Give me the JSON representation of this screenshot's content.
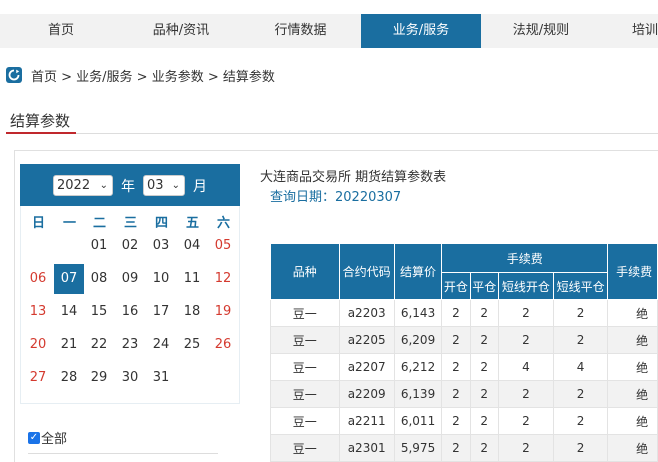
{
  "nav": {
    "items": [
      {
        "label": "首页",
        "active": false
      },
      {
        "label": "品种/资讯",
        "active": false
      },
      {
        "label": "行情数据",
        "active": false
      },
      {
        "label": "业务/服务",
        "active": true
      },
      {
        "label": "法规/规则",
        "active": false
      },
      {
        "label": "培训",
        "active": false
      }
    ]
  },
  "breadcrumb": {
    "text": "首页 > 业务/服务 > 业务参数 > 结算参数"
  },
  "section_title": "结算参数",
  "calendar": {
    "year": "2022",
    "year_unit": "年",
    "month": "03",
    "month_unit": "月",
    "weekdays": [
      "日",
      "一",
      "二",
      "三",
      "四",
      "五",
      "六"
    ],
    "days": [
      [
        "",
        "",
        "01",
        "02",
        "03",
        "04",
        "05"
      ],
      [
        "06",
        "07",
        "08",
        "09",
        "10",
        "11",
        "12"
      ],
      [
        "13",
        "14",
        "15",
        "16",
        "17",
        "18",
        "19"
      ],
      [
        "20",
        "21",
        "22",
        "23",
        "24",
        "25",
        "26"
      ],
      [
        "27",
        "28",
        "29",
        "30",
        "31",
        "",
        ""
      ]
    ],
    "selected_day": "07"
  },
  "filter": {
    "all_label": "全部",
    "all_checked": true
  },
  "report": {
    "title": "大连商品交易所 期货结算参数表",
    "query_date": "查询日期：20220307"
  },
  "table": {
    "headers": {
      "variety": "品种",
      "contract": "合约代码",
      "settle_price": "结算价",
      "fee_group": "手续费",
      "open": "开仓",
      "close": "平仓",
      "short_open": "短线开仓",
      "short_close": "短线平仓",
      "fee_mode": "手续费"
    },
    "rows": [
      {
        "variety": "豆一",
        "contract": "a2203",
        "price": "6,143",
        "open": "2",
        "close": "2",
        "short_open": "2",
        "short_close": "2",
        "mode": "绝"
      },
      {
        "variety": "豆一",
        "contract": "a2205",
        "price": "6,209",
        "open": "2",
        "close": "2",
        "short_open": "2",
        "short_close": "2",
        "mode": "绝"
      },
      {
        "variety": "豆一",
        "contract": "a2207",
        "price": "6,212",
        "open": "2",
        "close": "2",
        "short_open": "4",
        "short_close": "4",
        "mode": "绝"
      },
      {
        "variety": "豆一",
        "contract": "a2209",
        "price": "6,139",
        "open": "2",
        "close": "2",
        "short_open": "2",
        "short_close": "2",
        "mode": "绝"
      },
      {
        "variety": "豆一",
        "contract": "a2211",
        "price": "6,011",
        "open": "2",
        "close": "2",
        "short_open": "2",
        "short_close": "2",
        "mode": "绝"
      },
      {
        "variety": "豆一",
        "contract": "a2301",
        "price": "5,975",
        "open": "2",
        "close": "2",
        "short_open": "2",
        "short_close": "2",
        "mode": "绝"
      }
    ]
  },
  "colors": {
    "primary": "#1a6ea0",
    "weekend": "#d43a2f",
    "underline": "#c0282d",
    "checkbox": "#1a73e8"
  }
}
